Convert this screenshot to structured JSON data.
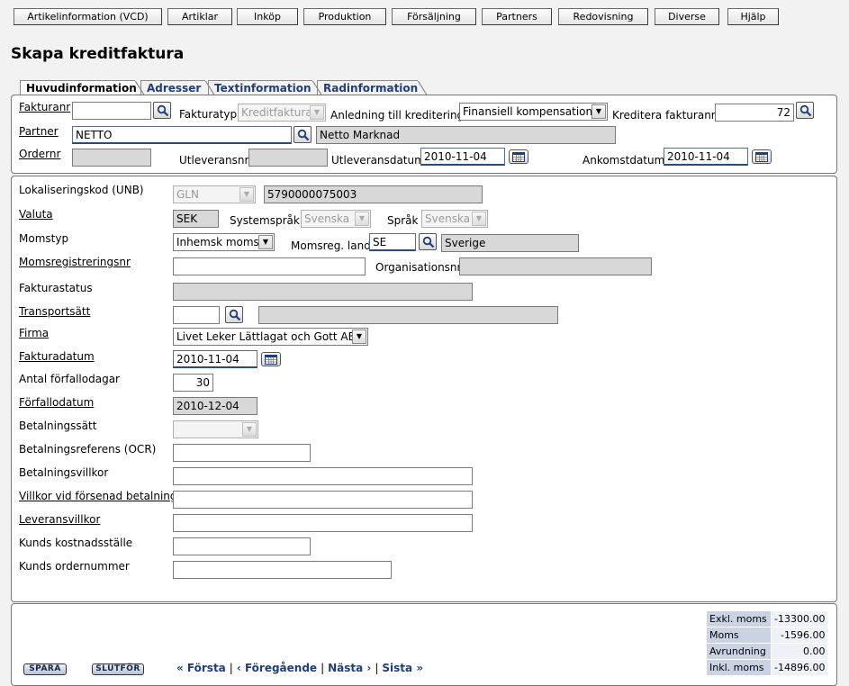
{
  "nav": [
    {
      "label": "Artikelinformation (VCD)"
    },
    {
      "label": "Artiklar"
    },
    {
      "label": "Inköp"
    },
    {
      "label": "Produktion"
    },
    {
      "label": "Försäljning"
    },
    {
      "label": "Partners"
    },
    {
      "label": "Redovisning"
    },
    {
      "label": "Diverse"
    },
    {
      "label": "Hjälp"
    }
  ],
  "page_title": "Skapa kreditfaktura",
  "tabs": [
    {
      "label": "Huvudinformation"
    },
    {
      "label": "Adresser"
    },
    {
      "label": "Textinformation"
    },
    {
      "label": "Radinformation"
    }
  ],
  "header": {
    "fakturanr_label": "Fakturanr",
    "fakturanr_value": "",
    "fakturatyp_label": "Fakturatyp",
    "fakturatyp_value": "Kreditfaktura",
    "anledning_label": "Anledning till kreditering",
    "anledning_value": "Finansiell kompensation",
    "kreditera_label": "Kreditera fakturanr",
    "kreditera_value": "72",
    "partner_label": "Partner",
    "partner_value": "NETTO",
    "partner_name": "Netto Marknad",
    "ordernr_label": "Ordernr",
    "ordernr_value": "",
    "utleveransnr_label": "Utleveransnr",
    "utleveransnr_value": "",
    "utleveransdatum_label": "Utleveransdatum",
    "utleveransdatum_value": "2010-11-04",
    "ankomstdatum_label": "Ankomstdatum",
    "ankomstdatum_value": "2010-11-04"
  },
  "main": {
    "lokalisering_label": "Lokaliseringskod (UNB)",
    "lokalisering_type": "GLN",
    "lokalisering_value": "5790000075003",
    "valuta_label": "Valuta",
    "valuta_value": "SEK",
    "systemsprak_label": "Systemspråk",
    "systemsprak_value": "Svenska",
    "sprak_label": "Språk",
    "sprak_value": "Svenska",
    "momstyp_label": "Momstyp",
    "momstyp_value": "Inhemsk moms",
    "momsreg_land_label": "Momsreg. land",
    "momsreg_land_code": "SE",
    "momsreg_land_name": "Sverige",
    "momsregnr_label": "Momsregistreringsnr",
    "momsregnr_value": "",
    "orgnr_label": "Organisationsnr",
    "orgnr_value": "",
    "fakturastatus_label": "Fakturastatus",
    "fakturastatus_value": "",
    "transport_label": "Transportsätt",
    "transport_value": "",
    "transport_name": "",
    "firma_label": "Firma",
    "firma_value": "Livet Leker Lättlagat och Gott AB",
    "fakturadatum_label": "Fakturadatum",
    "fakturadatum_value": "2010-11-04",
    "antal_label": "Antal förfallodagar",
    "antal_value": "30",
    "forfallodatum_label": "Förfallodatum",
    "forfallodatum_value": "2010-12-04",
    "betalningssatt_label": "Betalningssätt",
    "betalningssatt_value": "",
    "ocr_label": "Betalningsreferens (OCR)",
    "ocr_value": "",
    "betalningsvillkor_label": "Betalningsvillkor",
    "betalningsvillkor_value": "",
    "forsenad_label": "Villkor vid försenad betalning",
    "forsenad_value": "",
    "leveransvillkor_label": "Leveransvillkor",
    "leveransvillkor_value": "",
    "kostnadsstalle_label": "Kunds kostnadsställe",
    "kostnadsstalle_value": "",
    "kund_ordernr_label": "Kunds ordernummer",
    "kund_ordernr_value": ""
  },
  "footer": {
    "spara_label": "SPARA",
    "slutfor_label": "SLUTFÖR",
    "forsta": "« Första",
    "foregaende": "‹ Föregående",
    "nasta": "Nästa ›",
    "sista": "Sista »",
    "sep": "|",
    "totals": [
      {
        "label": "Exkl. moms",
        "value": "-13300.00"
      },
      {
        "label": "Moms",
        "value": "-1596.00"
      },
      {
        "label": "Avrundning",
        "value": "0.00"
      },
      {
        "label": "Inkl. moms",
        "value": "-14896.00"
      }
    ]
  },
  "icons": {
    "search": "magnifier-icon",
    "calendar": "calendar-icon",
    "dropdown": "chevron-down-icon"
  }
}
